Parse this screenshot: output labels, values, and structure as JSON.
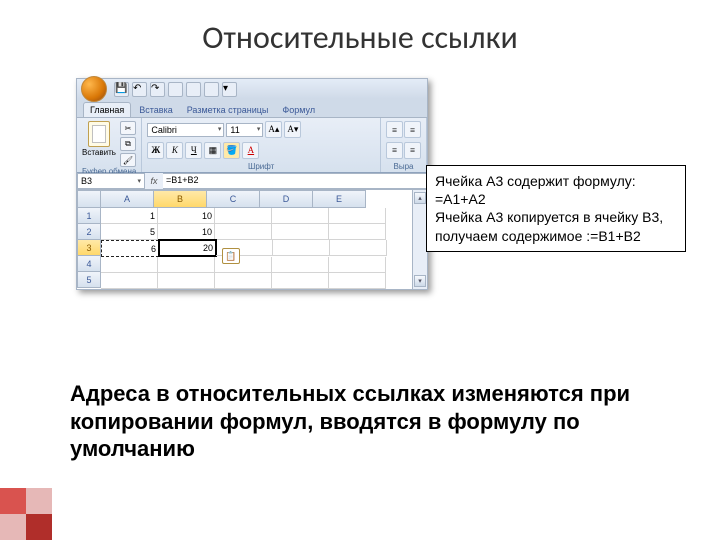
{
  "title": "Относительные ссылки",
  "tabs": [
    "Главная",
    "Вставка",
    "Разметка страницы",
    "Формул"
  ],
  "active_tab": 0,
  "ribbon": {
    "paste_label": "Вставить",
    "clipboard_group": "Буфер обмена",
    "font_name": "Calibri",
    "font_size": "11",
    "font_group": "Шрифт",
    "align_group": "Выра"
  },
  "namebox": "B3",
  "formula": "=B1+B2",
  "columns": [
    "A",
    "B",
    "C",
    "D",
    "E"
  ],
  "rows": [
    "1",
    "2",
    "3",
    "4",
    "5"
  ],
  "selected_row": 2,
  "selected_col": 1,
  "cells": [
    [
      "1",
      "10",
      "",
      "",
      ""
    ],
    [
      "5",
      "10",
      "",
      "",
      ""
    ],
    [
      "6",
      "20",
      "",
      "",
      ""
    ],
    [
      "",
      "",
      "",
      "",
      ""
    ],
    [
      "",
      "",
      "",
      "",
      ""
    ]
  ],
  "callout": {
    "line1": "Ячейка А3 содержит формулу: =А1+А2",
    "line2": "Ячейка А3 копируется в ячейку В3, получаем содержимое :=В1+В2"
  },
  "bottom": "Адреса в относительных ссылках изменяются при копировании формул, вводятся в формулу по умолчанию",
  "chart_data": null
}
